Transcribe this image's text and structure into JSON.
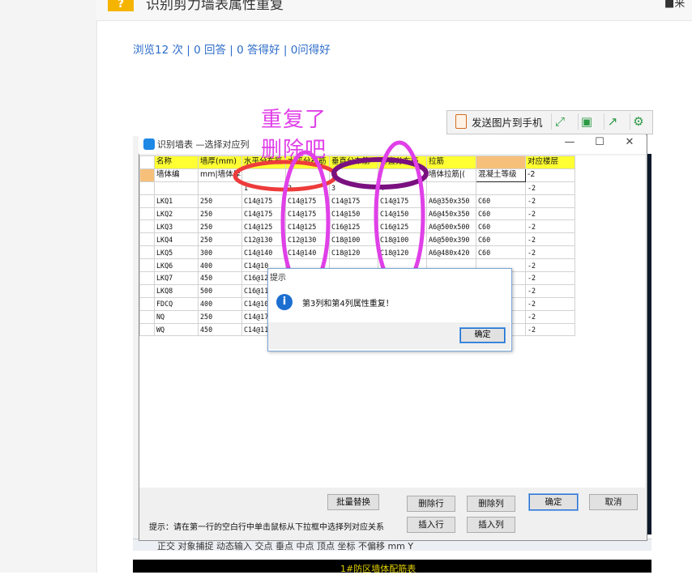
{
  "page": {
    "question_icon": "?",
    "question_title": "识别剪力墙表属性重复",
    "user_fragment": "来",
    "stats": {
      "views": "浏览12 次",
      "answers": "0 回答",
      "good_answers": "0 答得好",
      "got_good": "0问得好",
      "sep": " | "
    }
  },
  "phone_toolbar": {
    "send_label": "发送图片到手机",
    "icons": [
      "expand-icon",
      "save-icon",
      "share-icon",
      "settings-icon"
    ]
  },
  "annotations": {
    "line1": "重复了",
    "line2": "删除吧"
  },
  "dialog": {
    "title": "识别墙表 —选择对应列",
    "minimize": "—",
    "maximize": "☐",
    "close": "✕",
    "header_row": [
      "",
      "名称",
      "墙厚(mm)",
      "水平分布筋",
      "水平分布筋",
      "垂直分布筋",
      "垂直分布筋",
      "拉筋",
      "",
      "对应楼层"
    ],
    "sub_row": [
      "",
      "墙体编",
      "mm|墙体厚",
      "",
      "",
      "",
      "",
      "墙体拉筋|(",
      "混凝土等级",
      "-2"
    ],
    "index_row": [
      "",
      "",
      "",
      "1",
      "2",
      "3",
      "4",
      "",
      "",
      "-2"
    ],
    "rows": [
      [
        "",
        "LKQ1",
        "250",
        "C14@175",
        "C14@175",
        "C14@175",
        "C14@175",
        "A6@350x350",
        "C60",
        "-2"
      ],
      [
        "",
        "LKQ2",
        "250",
        "C14@175",
        "C14@175",
        "C14@150",
        "C14@150",
        "A6@450x350",
        "C60",
        "-2"
      ],
      [
        "",
        "LKQ3",
        "250",
        "C14@125",
        "C14@125",
        "C16@125",
        "C16@125",
        "A6@500x500",
        "C60",
        "-2"
      ],
      [
        "",
        "LKQ4",
        "250",
        "C12@130",
        "C12@130",
        "C18@100",
        "C18@100",
        "A6@500x390",
        "C60",
        "-2"
      ],
      [
        "",
        "LKQ5",
        "300",
        "C14@140",
        "C14@140",
        "C18@120",
        "C18@120",
        "A6@480x420",
        "C60",
        "-2"
      ],
      [
        "",
        "LKQ6",
        "400",
        "C14@10",
        "",
        "",
        "",
        "",
        "",
        "-2"
      ],
      [
        "",
        "LKQ7",
        "450",
        "C16@12",
        "",
        "",
        "",
        "",
        "",
        "-2"
      ],
      [
        "",
        "LKQ8",
        "500",
        "C16@11",
        "",
        "",
        "",
        "",
        "",
        "-2"
      ],
      [
        "",
        "FDCQ",
        "400",
        "C14@10",
        "",
        "",
        "",
        "",
        "",
        "-2"
      ],
      [
        "",
        "NQ",
        "250",
        "C14@17",
        "",
        "",
        "",
        "",
        "",
        "-2"
      ],
      [
        "",
        "WQ",
        "450",
        "C14@11",
        "",
        "",
        "",
        "",
        "",
        "-2"
      ]
    ],
    "buttons": {
      "batch_replace": "批量替换",
      "delete_row": "删除行",
      "delete_col": "删除列",
      "confirm": "确定",
      "cancel": "取消",
      "insert_row": "插入行",
      "insert_col": "插入列"
    },
    "hint": "提示：请在第一行的空白行中单击鼠标从下拉框中选择列对应关系"
  },
  "message_box": {
    "title": "提示",
    "icon": "i",
    "text": "第3列和第4列属性重复！",
    "ok": "确定"
  },
  "background_app": {
    "status_bar": "正交 对象捕捉 动态输入 交点 垂点 中点 顶点 坐标 不偏移 mm Y",
    "black_panel_text": "1#防区墙体配筋表"
  },
  "colors": {
    "header_yellow": "#ffff33",
    "selection_orange": "#f6c07a",
    "annotation_magenta": "#e040e8",
    "annotation_red": "#ee3b3b",
    "annotation_purple": "#7a1080",
    "link_blue": "#2c6cc8"
  }
}
